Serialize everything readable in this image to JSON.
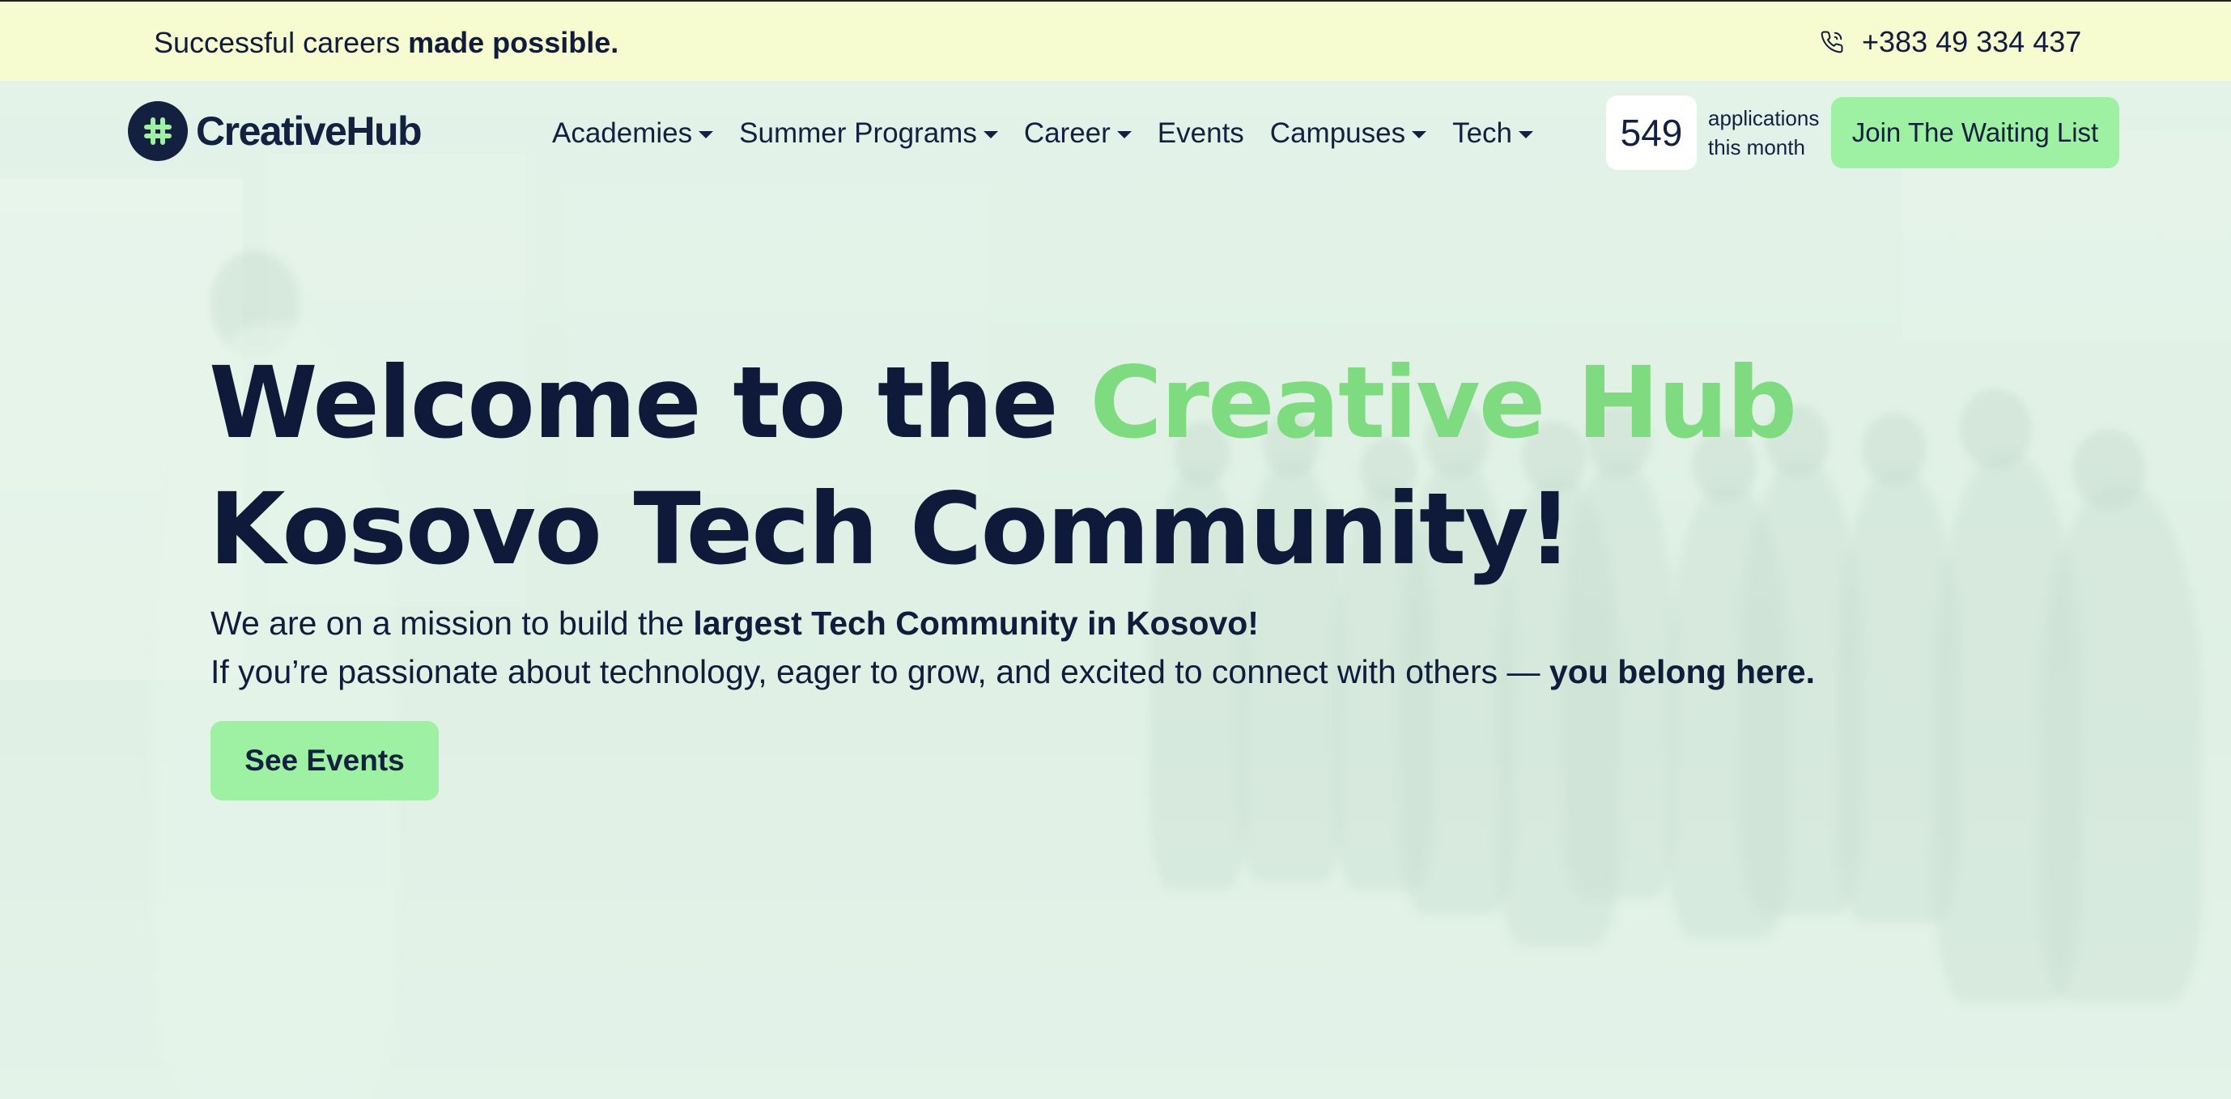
{
  "topbar": {
    "tagline_regular": "Successful careers",
    "tagline_bold": "made possible.",
    "phone": "+383 49 334 437",
    "phone_icon": "phone-icon",
    "background": "#f7fbd0"
  },
  "brand": {
    "name": "CreativeHub",
    "logo_icon": "hash-logo-icon",
    "mark_color": "#132040",
    "glyph_color": "#9ef0a2"
  },
  "nav": {
    "items": [
      {
        "label": "Academies",
        "dropdown": true
      },
      {
        "label": "Summer Programs",
        "dropdown": true
      },
      {
        "label": "Career",
        "dropdown": true
      },
      {
        "label": "Events",
        "dropdown": false
      },
      {
        "label": "Campuses",
        "dropdown": true
      },
      {
        "label": "Tech",
        "dropdown": true
      }
    ],
    "applications_count": "549",
    "applications_label_1": "applications",
    "applications_label_2": "this month",
    "cta_label": "Join The Waiting List"
  },
  "hero": {
    "title_part1": "Welcome to the ",
    "title_accent": "Creative Hub",
    "title_line2": "Kosovo Tech Community!",
    "sub_line1_regular": "We are on a mission to build the ",
    "sub_line1_bold": "largest Tech Community in Kosovo!",
    "sub_line2_regular": "If you’re passionate about technology, eager to grow, and excited to connect with others — ",
    "sub_line2_bold": "you belong here.",
    "cta_label": "See Events"
  },
  "colors": {
    "primary_dark": "#0f1a3a",
    "accent_green": "#7edb80",
    "button_green": "#9ef0a2"
  }
}
